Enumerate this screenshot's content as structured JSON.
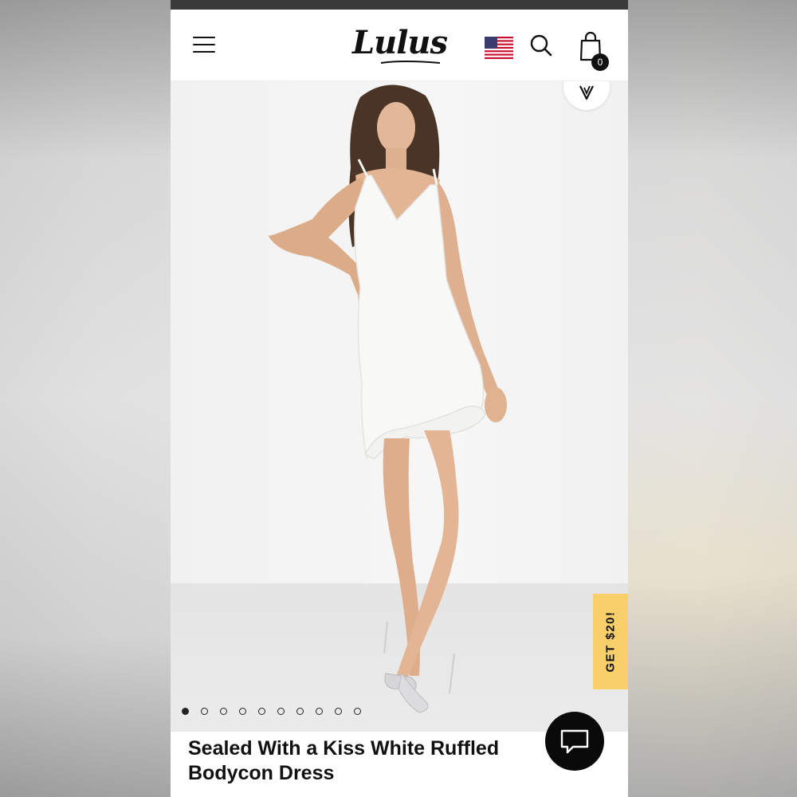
{
  "header": {
    "logo_text": "Lulus",
    "cart_count": "0",
    "icons": {
      "menu": "menu-icon",
      "flag": "us-flag-icon",
      "search": "search-icon",
      "bag": "shopping-bag-icon"
    }
  },
  "gallery": {
    "image": "model-white-ruffled-dress",
    "slide_count": 10,
    "active_slide": 1,
    "wishlist_icon": "heart-icon"
  },
  "promo": {
    "label": "GET $20!",
    "color": "#f8cf6a"
  },
  "product": {
    "title": "Sealed With a Kiss White Ruffled Bodycon Dress"
  },
  "chat": {
    "icon": "chat-bubble-icon"
  }
}
